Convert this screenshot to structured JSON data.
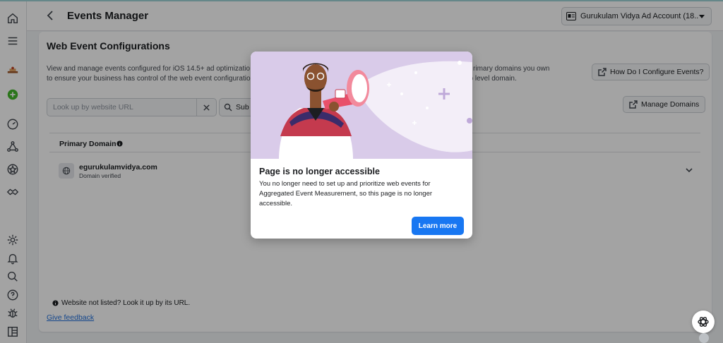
{
  "header": {
    "title": "Events Manager",
    "account_label": "Gurukulam Vidya Ad Account (18..."
  },
  "sidebar": {
    "icons": [
      "home-icon",
      "menu-icon",
      "business-logo-icon",
      "add-icon",
      "dashboard-icon",
      "data-sources-icon",
      "custom-conversions-icon",
      "partner-integrations-icon",
      "settings-icon",
      "notifications-icon",
      "search-icon",
      "help-icon",
      "debug-icon",
      "reports-icon"
    ]
  },
  "main": {
    "title": "Web Event Configurations",
    "description": "View and manage events configured for iOS 14.5+ ad optimization. … rimary domains you own to ensure your business has control of the web event configuratio … p level domain.",
    "description_line1": "View and manage events configured for iOS 14.5+ ad optimizatio",
    "description_line1b": "rimary domains you own",
    "description_line2": "to ensure your business has control of the web event configuratio",
    "description_line2b": "p level domain.",
    "configure_button": "How Do I Configure Events?",
    "manage_domains_button": "Manage Domains",
    "search_placeholder": "Look up by website URL",
    "submit_label": "Sub",
    "table_header": "Primary Domain",
    "rows": [
      {
        "domain": "egurukulamvidya.com",
        "status": "Domain verified"
      }
    ],
    "footnote": "Website not listed? Look it up by its URL.",
    "feedback": "Give feedback"
  },
  "modal": {
    "title": "Page is no longer accessible",
    "body": "You no longer need to set up and prioritize web events for Aggregated Event Measurement, so this page is no longer accessible.",
    "button": "Learn more"
  },
  "colors": {
    "accent": "#1877f2",
    "overlay": "rgba(0,0,0,0.36)",
    "illustration_bg": "#d8c8e8"
  }
}
